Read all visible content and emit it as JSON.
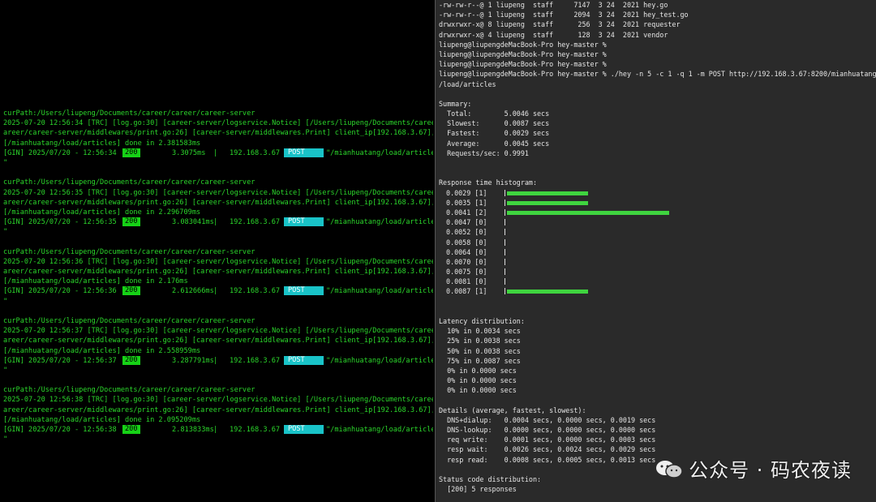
{
  "left_terminal": {
    "blocks": [
      {
        "cur_path": "curPath:/Users/liupeng/Documents/career/career/career-server",
        "log1": "2025-07-20 12:56:34 [TRC] [log.go:30] [career-server/logservice.Notice] [/Users/liupeng/Documents/career/c",
        "log2": "areer/career-server/middlewares/print.go:26] [career-server/middlewares.Print] client_ip[192.168.3.67],uri",
        "log3": "[/mianhuatang/load/articles] done in 2.381583ms",
        "gin_prefix": "[GIN] 2025/07/20 - 12:56:34 |",
        "status": "200",
        "latency": "3.3075ms",
        "ip": "192.168.3.67",
        "method": "POST",
        "path": "\"/mianhuatang/load/articles",
        "tail": "\""
      },
      {
        "cur_path": "curPath:/Users/liupeng/Documents/career/career/career-server",
        "log1": "2025-07-20 12:56:35 [TRC] [log.go:30] [career-server/logservice.Notice] [/Users/liupeng/Documents/career/c",
        "log2": "areer/career-server/middlewares/print.go:26] [career-server/middlewares.Print] client_ip[192.168.3.67],uri",
        "log3": "[/mianhuatang/load/articles] done in 2.296709ms",
        "gin_prefix": "[GIN] 2025/07/20 - 12:56:35 |",
        "status": "200",
        "latency": "3.083041ms",
        "ip": "192.168.3.67",
        "method": "POST",
        "path": "\"/mianhuatang/load/articles",
        "tail": "\""
      },
      {
        "cur_path": "curPath:/Users/liupeng/Documents/career/career/career-server",
        "log1": "2025-07-20 12:56:36 [TRC] [log.go:30] [career-server/logservice.Notice] [/Users/liupeng/Documents/career/c",
        "log2": "areer/career-server/middlewares/print.go:26] [career-server/middlewares.Print] client_ip[192.168.3.67],uri",
        "log3": "[/mianhuatang/load/articles] done in 2.176ms",
        "gin_prefix": "[GIN] 2025/07/20 - 12:56:36 |",
        "status": "200",
        "latency": "2.612666ms",
        "ip": "192.168.3.67",
        "method": "POST",
        "path": "\"/mianhuatang/load/articles",
        "tail": "\""
      },
      {
        "cur_path": "curPath:/Users/liupeng/Documents/career/career/career-server",
        "log1": "2025-07-20 12:56:37 [TRC] [log.go:30] [career-server/logservice.Notice] [/Users/liupeng/Documents/career/c",
        "log2": "areer/career-server/middlewares/print.go:26] [career-server/middlewares.Print] client_ip[192.168.3.67],uri",
        "log3": "[/mianhuatang/load/articles] done in 2.558959ms",
        "gin_prefix": "[GIN] 2025/07/20 - 12:56:37 |",
        "status": "200",
        "latency": "3.287791ms",
        "ip": "192.168.3.67",
        "method": "POST",
        "path": "\"/mianhuatang/load/articles",
        "tail": "\""
      },
      {
        "cur_path": "curPath:/Users/liupeng/Documents/career/career/career-server",
        "log1": "2025-07-20 12:56:38 [TRC] [log.go:30] [career-server/logservice.Notice] [/Users/liupeng/Documents/career/c",
        "log2": "areer/career-server/middlewares/print.go:26] [career-server/middlewares.Print] client_ip[192.168.3.67],uri",
        "log3": "[/mianhuatang/load/articles] done in 2.095209ms",
        "gin_prefix": "[GIN] 2025/07/20 - 12:56:38 |",
        "status": "200",
        "latency": "2.813833ms",
        "ip": "192.168.3.67",
        "method": "POST",
        "path": "\"/mianhuatang/load/articles",
        "tail": "\""
      }
    ]
  },
  "right_terminal": {
    "files": [
      "-rw-rw-r--@ 1 liupeng  staff     7147  3 24  2021 hey.go",
      "-rw-rw-r--@ 1 liupeng  staff     2094  3 24  2021 hey_test.go",
      "drwxrwxr-x@ 8 liupeng  staff      256  3 24  2021 requester",
      "drwxrwxr-x@ 4 liupeng  staff      128  3 24  2021 vendor"
    ],
    "prompts": [
      "liupeng@liupengdeMacBook-Pro hey-master %",
      "liupeng@liupengdeMacBook-Pro hey-master %",
      "liupeng@liupengdeMacBook-Pro hey-master %"
    ],
    "command": "liupeng@liupengdeMacBook-Pro hey-master % ./hey -n 5 -c 1 -q 1 -m POST http://192.168.3.67:8200/mianhuatang",
    "command_cont": "/load/articles",
    "summary_title": "Summary:",
    "summary": [
      "  Total:        5.0046 secs",
      "  Slowest:      0.0087 secs",
      "  Fastest:      0.0029 secs",
      "  Average:      0.0045 secs",
      "  Requests/sec: 0.9991"
    ],
    "histogram_title": "Response time histogram:",
    "histogram": [
      {
        "label": "0.0029 [1]",
        "count": 1
      },
      {
        "label": "0.0035 [1]",
        "count": 1
      },
      {
        "label": "0.0041 [2]",
        "count": 2
      },
      {
        "label": "0.0047 [0]",
        "count": 0
      },
      {
        "label": "0.0052 [0]",
        "count": 0
      },
      {
        "label": "0.0058 [0]",
        "count": 0
      },
      {
        "label": "0.0064 [0]",
        "count": 0
      },
      {
        "label": "0.0070 [0]",
        "count": 0
      },
      {
        "label": "0.0075 [0]",
        "count": 0
      },
      {
        "label": "0.0081 [0]",
        "count": 0
      },
      {
        "label": "0.0087 [1]",
        "count": 1
      }
    ],
    "latency_title": "Latency distribution:",
    "latency": [
      "  10% in 0.0034 secs",
      "  25% in 0.0038 secs",
      "  50% in 0.0038 secs",
      "  75% in 0.0087 secs",
      "  0% in 0.0000 secs",
      "  0% in 0.0000 secs",
      "  0% in 0.0000 secs"
    ],
    "details_title": "Details (average, fastest, slowest):",
    "details": [
      "  DNS+dialup:   0.0004 secs, 0.0000 secs, 0.0019 secs",
      "  DNS-lookup:   0.0000 secs, 0.0000 secs, 0.0000 secs",
      "  req write:    0.0001 secs, 0.0000 secs, 0.0003 secs",
      "  resp wait:    0.0026 secs, 0.0024 secs, 0.0029 secs",
      "  resp read:    0.0008 secs, 0.0005 secs, 0.0013 secs"
    ],
    "status_title": "Status code distribution:",
    "status": "  [200] 5 responses"
  },
  "watermark": {
    "text": "公众号 · 码农夜读",
    "icon": "wechat-icon"
  },
  "colors": {
    "log_green": "#2bd62b",
    "status_badge": "#16d216",
    "method_badge": "#19c3c8",
    "histogram_bar": "#3fd43f"
  }
}
